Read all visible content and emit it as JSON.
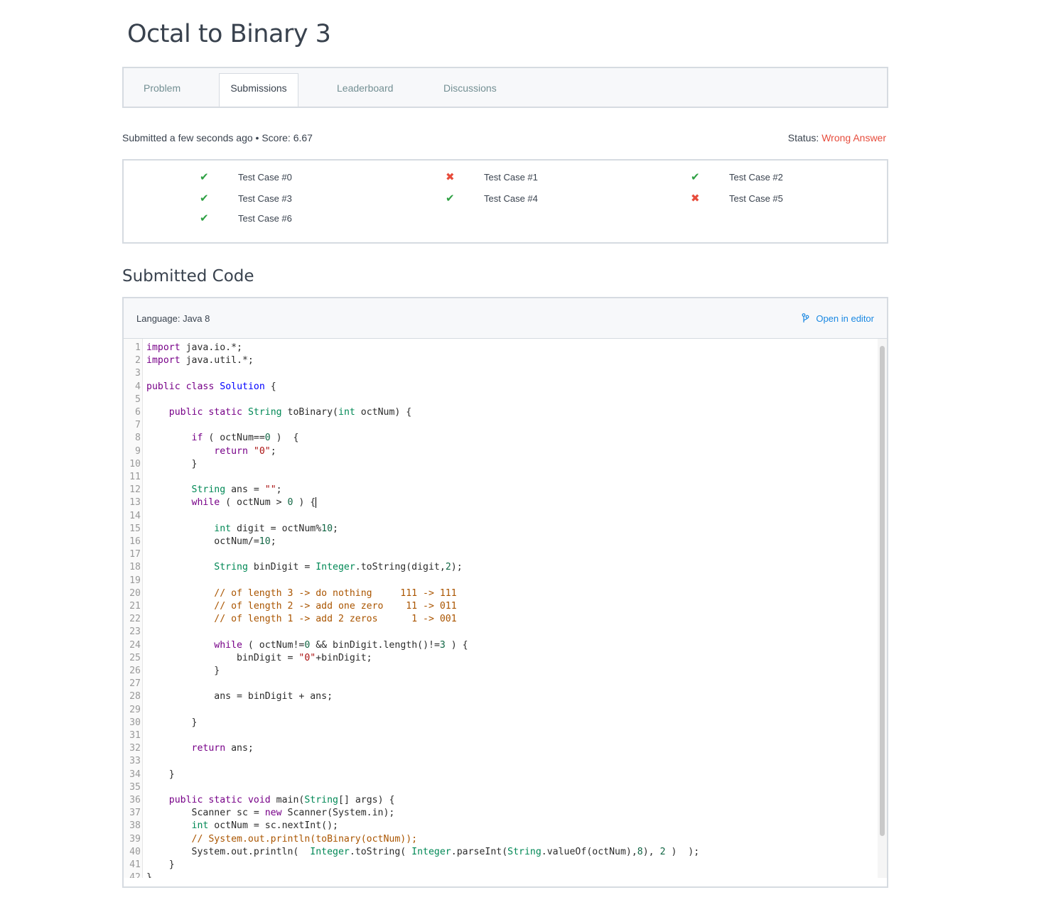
{
  "page": {
    "title": "Octal to Binary 3"
  },
  "tabs": [
    {
      "label": "Problem",
      "active": false
    },
    {
      "label": "Submissions",
      "active": true
    },
    {
      "label": "Leaderboard",
      "active": false
    },
    {
      "label": "Discussions",
      "active": false
    }
  ],
  "submission": {
    "meta": "Submitted a few seconds ago • Score: 6.67",
    "status_label": "Status:",
    "status_value": "Wrong Answer",
    "status_color": "#e74c3c"
  },
  "test_cases": [
    {
      "label": "Test Case #0",
      "result": "pass",
      "icon": "check-icon"
    },
    {
      "label": "Test Case #1",
      "result": "fail",
      "icon": "cross-icon"
    },
    {
      "label": "Test Case #2",
      "result": "pass",
      "icon": "check-icon"
    },
    {
      "label": "Test Case #3",
      "result": "pass",
      "icon": "check-icon"
    },
    {
      "label": "Test Case #4",
      "result": "pass",
      "icon": "check-icon"
    },
    {
      "label": "Test Case #5",
      "result": "fail",
      "icon": "cross-icon"
    },
    {
      "label": "Test Case #6",
      "result": "pass",
      "icon": "check-icon"
    }
  ],
  "code_section": {
    "title": "Submitted Code",
    "language": "Language: Java 8",
    "open_in_editor": "Open in editor",
    "open_icon": "branch-icon"
  },
  "code_lines": [
    "import java.io.*;",
    "import java.util.*;",
    "",
    "public class Solution {",
    "",
    "    public static String toBinary(int octNum) {",
    "",
    "        if ( octNum==0 )  {",
    "            return \"0\";",
    "        }",
    "",
    "        String ans = \"\";",
    "        while ( octNum > 0 ) {",
    "",
    "            int digit = octNum%10;",
    "            octNum/=10;",
    "",
    "            String binDigit = Integer.toString(digit,2);",
    "",
    "            // of length 3 -> do nothing     111 -> 111",
    "            // of length 2 -> add one zero    11 -> 011",
    "            // of length 1 -> add 2 zeros      1 -> 001",
    "",
    "            while ( octNum!=0 && binDigit.length()!=3 ) {",
    "                binDigit = \"0\"+binDigit;",
    "            }",
    "",
    "            ans = binDigit + ans;",
    "",
    "        }",
    "",
    "        return ans;",
    "",
    "    }",
    "",
    "    public static void main(String[] args) {",
    "        Scanner sc = new Scanner(System.in);",
    "        int octNum = sc.nextInt();",
    "        // System.out.println(toBinary(octNum));",
    "        System.out.println(  Integer.toString( Integer.parseInt(String.valueOf(octNum),8), 2 )  );",
    "    }",
    "}"
  ]
}
